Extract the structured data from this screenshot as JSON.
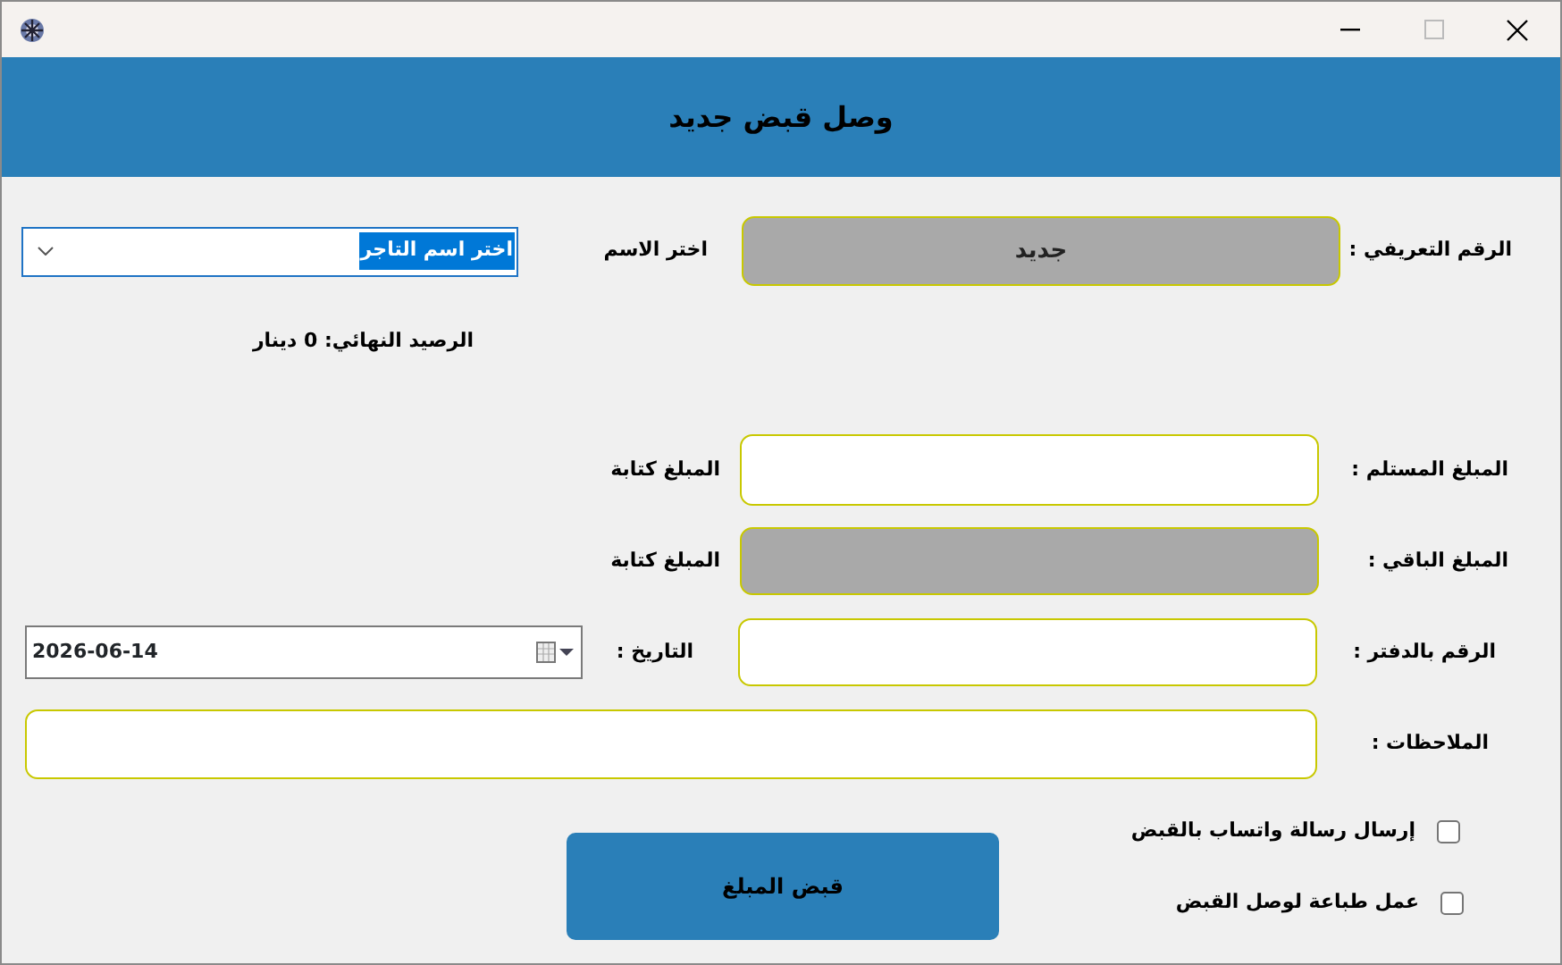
{
  "header": {
    "title": "وصل قبض جديد"
  },
  "id_field": {
    "label": "الرقم التعريفي :",
    "value": "جديد",
    "disabled": true
  },
  "name_select": {
    "label": "اختر الاسم",
    "value": "اختر اسم التاجر",
    "highlighted": true
  },
  "balance": "الرصيد النهائي: 0 دينار",
  "amount_rows": [
    {
      "label": "المبلغ المستلم :",
      "in_words": "المبلغ كتابة",
      "disabled": false
    },
    {
      "label": "المبلغ الباقي :",
      "in_words": "المبلغ كتابة",
      "disabled": true
    }
  ],
  "book_number": {
    "label": "الرقم بالدفتر :",
    "disabled": false
  },
  "date": {
    "label": "التاريخ :",
    "value": "2026-06-14"
  },
  "notes": {
    "label": "الملاحظات :",
    "disabled": false
  },
  "submit_button": "قبض المبلغ",
  "options": [
    {
      "label": "إرسال رسالة واتساب بالقبض",
      "checked": false
    },
    {
      "label": "عمل طباعة لوصل القبض",
      "checked": false
    }
  ]
}
